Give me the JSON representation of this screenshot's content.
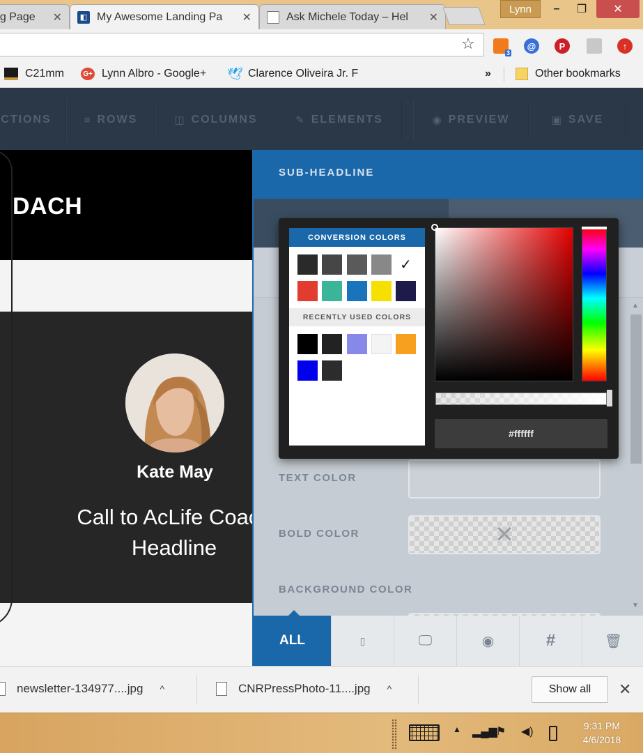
{
  "browser": {
    "tabs": [
      {
        "title": "ng Page",
        "active": false
      },
      {
        "title": "My Awesome Landing Pa",
        "active": true
      },
      {
        "title": "Ask Michele Today – Hel",
        "active": false
      }
    ],
    "tab_close_glyph": "✕",
    "window_user": "Lynn",
    "window_controls": {
      "minimize": "–",
      "maximize": "❐",
      "close": "✕"
    },
    "bookmark_star": "☆",
    "extensions": [
      {
        "icon": "ext-stack-icon",
        "color": "#f07a1c",
        "badge": "3"
      },
      {
        "icon": "ext-at-icon",
        "color": "#3b6fd8",
        "glyph": "a"
      },
      {
        "icon": "pinterest-icon",
        "color": "#cb2027",
        "glyph": "P"
      },
      {
        "icon": "ext-gray-icon",
        "color": "#c8c8c8",
        "glyph": ""
      },
      {
        "icon": "ext-up-icon",
        "color": "#d93025",
        "glyph": "↑"
      }
    ],
    "bookmarks": [
      {
        "label": "C21mm",
        "icon": "c21-icon"
      },
      {
        "label": "Lynn Albro - Google+",
        "icon": "google-plus-icon"
      },
      {
        "label": "Clarence Oliveira Jr. F",
        "icon": "twitter-icon"
      }
    ],
    "bookmarks_overflow": "»",
    "other_bookmarks": "Other bookmarks"
  },
  "builder": {
    "toolbar": [
      {
        "label": "CTIONS",
        "icon": ""
      },
      {
        "label": "ROWS",
        "icon": "≡"
      },
      {
        "label": "COLUMNS",
        "icon": "◫"
      },
      {
        "label": "ELEMENTS",
        "icon": "✎"
      },
      {
        "label": "PREVIEW",
        "icon": "◉"
      },
      {
        "label": "SAVE",
        "icon": "▣"
      }
    ]
  },
  "canvas": {
    "heading_fragment": "DACH",
    "name": "Kate May",
    "headline_line1": "Call to AcLife Coach",
    "headline_line2": "Headline"
  },
  "panel": {
    "title": "SUB-HEADLINE",
    "labels": {
      "text_color": "TEXT COLOR",
      "bold_color": "BOLD COLOR",
      "background_color": "BACKGROUND COLOR"
    },
    "footer_tabs": [
      {
        "label": "ALL",
        "icon": ""
      },
      {
        "label": "",
        "icon": "mobile-icon",
        "glyph": "▯"
      },
      {
        "label": "",
        "icon": "desktop-icon",
        "glyph": "🖵"
      },
      {
        "label": "",
        "icon": "eye-icon",
        "glyph": "◉"
      },
      {
        "label": "",
        "icon": "hash-icon",
        "glyph": "#"
      },
      {
        "label": "",
        "icon": "trash-icon",
        "glyph": "🗑"
      }
    ]
  },
  "color_picker": {
    "conversion_title": "CONVERSION COLORS",
    "recent_title": "RECENTLY USED COLORS",
    "conversion_colors": [
      "#2a2a2a",
      "#464646",
      "#5a5a5a",
      "#888888",
      "#ffffff",
      "#e23b30",
      "#3bb59a",
      "#1a74bb",
      "#f5e000",
      "#1e1a4a"
    ],
    "selected_check": "✓",
    "recent_colors": [
      "#000000",
      "#222222",
      "#8888e8",
      "#f4f4f4",
      "#f7a020",
      "#0000ee",
      "#2c2c2c"
    ],
    "hex_value": "#ffffff",
    "bold_color_clear": "✕"
  },
  "downloads": {
    "items": [
      {
        "name": "newsletter-134977....jpg"
      },
      {
        "name": "CNRPressPhoto-11....jpg"
      }
    ],
    "caret": "^",
    "show_all": "Show all",
    "close": "✕"
  },
  "taskbar": {
    "time": "9:31 PM",
    "date": "4/6/2018",
    "tray_icons": [
      "chevron-up-icon",
      "signal-icon",
      "flag-icon",
      "volume-icon",
      "battery-icon"
    ]
  }
}
